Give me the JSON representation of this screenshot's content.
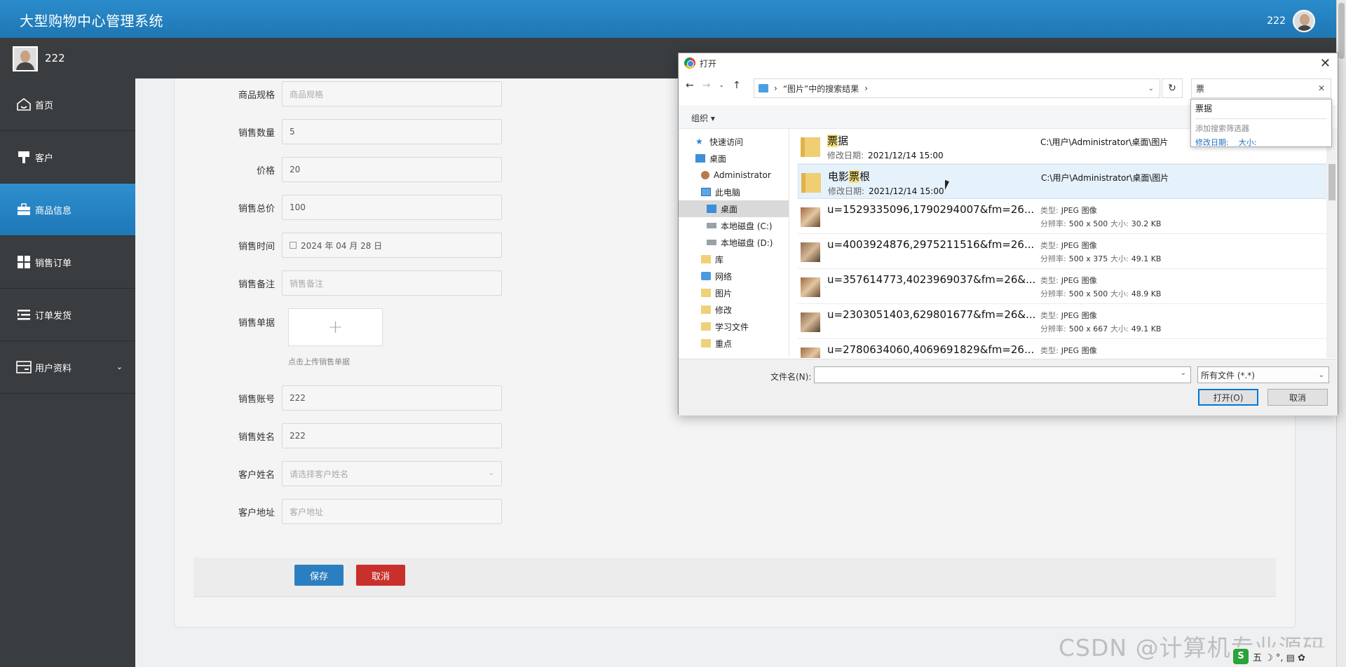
{
  "header": {
    "title": "大型购物中心管理系统",
    "username": "222"
  },
  "userbar": {
    "username": "222"
  },
  "sidebar": {
    "items": [
      {
        "label": "首页",
        "icon": "home-icon",
        "active": false
      },
      {
        "label": "客户",
        "icon": "brush-icon",
        "active": false
      },
      {
        "label": "商品信息",
        "icon": "briefcase-icon",
        "active": true
      },
      {
        "label": "销售订单",
        "icon": "grid-icon",
        "active": false
      },
      {
        "label": "订单发货",
        "icon": "list-icon",
        "active": false
      },
      {
        "label": "用户资料",
        "icon": "card-icon",
        "active": false,
        "has_submenu": true
      }
    ]
  },
  "form": {
    "spec": {
      "label": "商品规格",
      "placeholder": "商品规格"
    },
    "qty": {
      "label": "销售数量",
      "value": "5"
    },
    "price": {
      "label": "价格",
      "value": "20"
    },
    "total": {
      "label": "销售总价",
      "value": "100"
    },
    "time": {
      "label": "销售时间",
      "value": "2024 年 04 月 28 日"
    },
    "note": {
      "label": "销售备注",
      "placeholder": "销售备注"
    },
    "receipt": {
      "label": "销售单据",
      "hint": "点击上传销售单据",
      "plus": "+"
    },
    "account": {
      "label": "销售账号",
      "value": "222"
    },
    "name": {
      "label": "销售姓名",
      "value": "222"
    },
    "customer": {
      "label": "客户姓名",
      "placeholder": "请选择客户姓名"
    },
    "address": {
      "label": "客户地址",
      "placeholder": "客户地址"
    },
    "save": "保存",
    "cancel": "取消"
  },
  "watermark": "CSDN @计算机专业源码",
  "tray": {
    "logo": "S",
    "text": "五 ☽ °, ▤ ✿"
  },
  "dialog": {
    "title": "打开",
    "path": "“图片”中的搜索结果",
    "search": "票",
    "search_popup": {
      "suggestion": "票据",
      "add_filter": "添加搜索筛选器",
      "filter1": "修改日期:",
      "filter2": "大小:"
    },
    "organize": "组织 ▾",
    "tree": [
      {
        "label": "快速访问",
        "icon": "star-icon",
        "indent": 1
      },
      {
        "label": "桌面",
        "icon": "desktop-icon",
        "indent": 1
      },
      {
        "label": "Administrator",
        "icon": "user-icon",
        "indent": 2
      },
      {
        "label": "此电脑",
        "icon": "pc-icon",
        "indent": 2
      },
      {
        "label": "桌面",
        "icon": "desktop-icon",
        "indent": 3,
        "selected": true
      },
      {
        "label": "本地磁盘 (C:)",
        "icon": "disk-icon",
        "indent": 3
      },
      {
        "label": "本地磁盘 (D:)",
        "icon": "disk-icon",
        "indent": 3
      },
      {
        "label": "库",
        "icon": "library-icon",
        "indent": 2
      },
      {
        "label": "网络",
        "icon": "network-icon",
        "indent": 2
      },
      {
        "label": "图片",
        "icon": "folder-icon",
        "indent": 2
      },
      {
        "label": "修改",
        "icon": "folder-icon",
        "indent": 2
      },
      {
        "label": "学习文件",
        "icon": "folder-icon",
        "indent": 2
      },
      {
        "label": "重点",
        "icon": "folder-icon",
        "indent": 2
      }
    ],
    "files": [
      {
        "pre": "",
        "hl": "票",
        "post": "据",
        "date_label": "修改日期:",
        "date": "2021/12/14 15:00",
        "path": "C:\\用户\\Administrator\\桌面\\图片",
        "kind": "folder"
      },
      {
        "pre": "电影",
        "hl": "票",
        "post": "根",
        "date_label": "修改日期:",
        "date": "2021/12/14 15:00",
        "path": "C:\\用户\\Administrator\\桌面\\图片",
        "kind": "folder",
        "hover": true
      },
      {
        "name": "u=1529335096,1790294007&fm=26...",
        "type_label": "类型:",
        "type": "JPEG 图像",
        "res_label": "分辨率:",
        "res": "500 x 500",
        "size_label": "大小:",
        "size": "30.2 KB",
        "kind": "photo"
      },
      {
        "name": "u=4003924876,2975211516&fm=26...",
        "type_label": "类型:",
        "type": "JPEG 图像",
        "res_label": "分辨率:",
        "res": "500 x 375",
        "size_label": "大小:",
        "size": "49.1 KB",
        "kind": "photo"
      },
      {
        "name": "u=357614773,4023969037&fm=26&...",
        "type_label": "类型:",
        "type": "JPEG 图像",
        "res_label": "分辨率:",
        "res": "500 x 500",
        "size_label": "大小:",
        "size": "48.9 KB",
        "kind": "photo"
      },
      {
        "name": "u=2303051403,629801677&fm=26&...",
        "type_label": "类型:",
        "type": "JPEG 图像",
        "res_label": "分辨率:",
        "res": "500 x 667",
        "size_label": "大小:",
        "size": "49.1 KB",
        "kind": "photo"
      },
      {
        "name": "u=2780634060,4069691829&fm=26...",
        "type_label": "类型:",
        "type": "JPEG 图像",
        "kind": "photo"
      }
    ],
    "filename_label": "文件名(N):",
    "filetype": "所有文件 (*.*)",
    "open": "打开(O)",
    "cancel": "取消"
  }
}
